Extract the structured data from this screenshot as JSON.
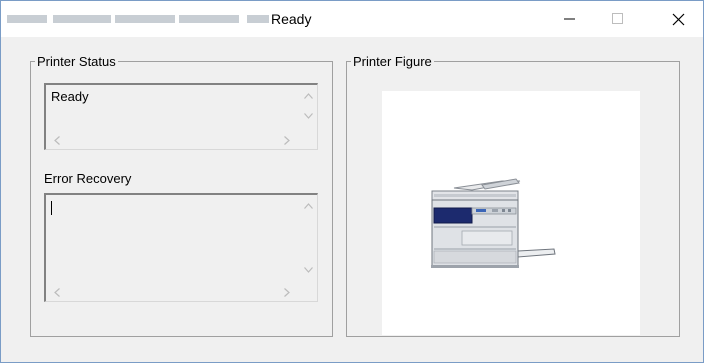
{
  "window": {
    "title": "Ready",
    "minimize_glyph": "–",
    "maximize_glyph": "☐",
    "close_glyph": "✕"
  },
  "printer_status": {
    "legend": "Printer Status",
    "value": "Ready"
  },
  "error_recovery": {
    "label": "Error Recovery",
    "value": ""
  },
  "printer_figure": {
    "legend": "Printer Figure"
  },
  "scroll": {
    "up": "^",
    "down": "v",
    "left": "<",
    "right": ">"
  },
  "colors": {
    "panel_bg": "#f0f0f0",
    "figure_bg": "#ffffff",
    "printer_body": "#d9dde2",
    "printer_panel": "#1c2a6e"
  }
}
